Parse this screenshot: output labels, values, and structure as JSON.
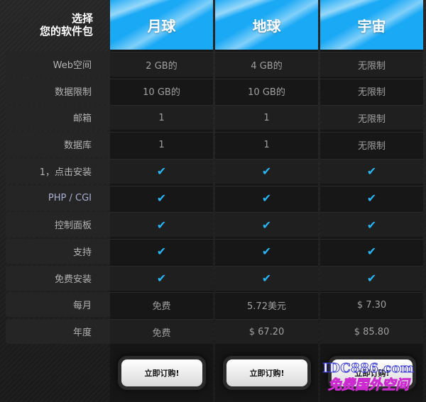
{
  "caption": {
    "line1": "选择",
    "line2": "您的软件包"
  },
  "plans": [
    "月球",
    "地球",
    "宇宙"
  ],
  "rows": [
    {
      "label": "Web空间",
      "values": [
        "2 GB的",
        "4 GB的",
        "无限制"
      ]
    },
    {
      "label": "数据限制",
      "values": [
        "10 GB的",
        "10 GB的",
        "无限制"
      ]
    },
    {
      "label": "邮箱",
      "values": [
        "1",
        "1",
        "无限制"
      ]
    },
    {
      "label": "数据库",
      "values": [
        "1",
        "1",
        "无限制"
      ]
    },
    {
      "label": "1，点击安装",
      "values": [
        "✔",
        "✔",
        "✔"
      ]
    },
    {
      "label": "PHP / CGI",
      "values": [
        "✔",
        "✔",
        "✔"
      ]
    },
    {
      "label": "控制面板",
      "values": [
        "✔",
        "✔",
        "✔"
      ]
    },
    {
      "label": "支持",
      "values": [
        "✔",
        "✔",
        "✔"
      ]
    },
    {
      "label": "免费安装",
      "values": [
        "✔",
        "✔",
        "✔"
      ]
    },
    {
      "label": "每月",
      "values": [
        "免费",
        "5.72美元",
        "$ 7.30"
      ]
    },
    {
      "label": "年度",
      "values": [
        "免费",
        "$ 67.20",
        "$ 85.80"
      ]
    }
  ],
  "order_button_label": "立即订购!",
  "watermark": {
    "line1": "IDC886.com",
    "line2": "免费国外空间"
  },
  "colors": {
    "header_blue": "#1aa9f5",
    "check_blue": "#29b6f6"
  }
}
